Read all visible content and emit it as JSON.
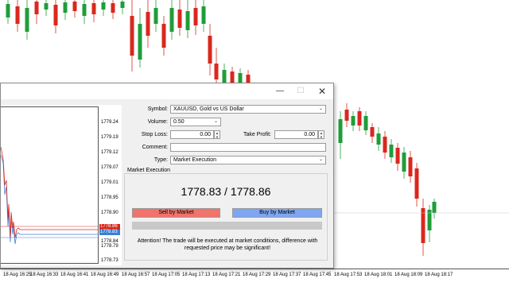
{
  "chart": {
    "time_labels": [
      "18 Aug 16:25",
      "18 Aug 16:33",
      "18 Aug 16:41",
      "18 Aug 16:49",
      "18 Aug 16:57",
      "18 Aug 17:05",
      "18 Aug 17:13",
      "18 Aug 17:21",
      "18 Aug 17:29",
      "18 Aug 17:37",
      "18 Aug 17:45",
      "18 Aug 17:53",
      "18 Aug 18:01",
      "18 Aug 18:09",
      "18 Aug 18:17"
    ],
    "colors": {
      "bull": "#1f9d3a",
      "bear": "#d9281e",
      "bid_line": "#d9281e",
      "ask_line": "#3c7fd6"
    }
  },
  "dialog": {
    "title_buttons": {
      "minimize": "—",
      "maximize": "☐",
      "close": "✕"
    },
    "mini_chart": {
      "price_ticks": [
        "1779.24",
        "1779.19",
        "1779.12",
        "1779.07",
        "1779.01",
        "1778.95",
        "1778.90",
        "1778.84",
        "1778.79",
        "1778.73"
      ],
      "ask_tag": "1778.86",
      "bid_tag": "1778.83"
    },
    "symbol": {
      "label": "Symbol:",
      "value": "XAUUSD, Gold vs US Dollar"
    },
    "volume": {
      "label": "Volume:",
      "value": "0.50"
    },
    "stop_loss": {
      "label": "Stop Loss:",
      "value": "0.00"
    },
    "take_profit": {
      "label": "Take Profit:",
      "value": "0.00"
    },
    "comment": {
      "label": "Comment:",
      "value": ""
    },
    "type": {
      "label": "Type:",
      "value": "Market Execution"
    },
    "market_execution": {
      "section_title": "Market Execution",
      "price_display": "1778.83 / 1778.86",
      "sell_label": "Sell by Market",
      "buy_label": "Buy by Market",
      "warning": "Attention! The trade will be executed at market conditions, difference with requested price may be significant!"
    }
  }
}
